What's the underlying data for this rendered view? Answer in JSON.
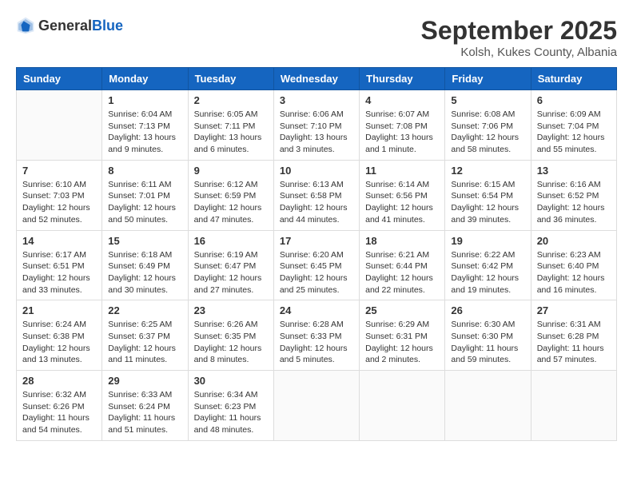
{
  "logo": {
    "general": "General",
    "blue": "Blue"
  },
  "header": {
    "month": "September 2025",
    "location": "Kolsh, Kukes County, Albania"
  },
  "weekdays": [
    "Sunday",
    "Monday",
    "Tuesday",
    "Wednesday",
    "Thursday",
    "Friday",
    "Saturday"
  ],
  "weeks": [
    [
      {
        "day": "",
        "info": ""
      },
      {
        "day": "1",
        "info": "Sunrise: 6:04 AM\nSunset: 7:13 PM\nDaylight: 13 hours\nand 9 minutes."
      },
      {
        "day": "2",
        "info": "Sunrise: 6:05 AM\nSunset: 7:11 PM\nDaylight: 13 hours\nand 6 minutes."
      },
      {
        "day": "3",
        "info": "Sunrise: 6:06 AM\nSunset: 7:10 PM\nDaylight: 13 hours\nand 3 minutes."
      },
      {
        "day": "4",
        "info": "Sunrise: 6:07 AM\nSunset: 7:08 PM\nDaylight: 13 hours\nand 1 minute."
      },
      {
        "day": "5",
        "info": "Sunrise: 6:08 AM\nSunset: 7:06 PM\nDaylight: 12 hours\nand 58 minutes."
      },
      {
        "day": "6",
        "info": "Sunrise: 6:09 AM\nSunset: 7:04 PM\nDaylight: 12 hours\nand 55 minutes."
      }
    ],
    [
      {
        "day": "7",
        "info": "Sunrise: 6:10 AM\nSunset: 7:03 PM\nDaylight: 12 hours\nand 52 minutes."
      },
      {
        "day": "8",
        "info": "Sunrise: 6:11 AM\nSunset: 7:01 PM\nDaylight: 12 hours\nand 50 minutes."
      },
      {
        "day": "9",
        "info": "Sunrise: 6:12 AM\nSunset: 6:59 PM\nDaylight: 12 hours\nand 47 minutes."
      },
      {
        "day": "10",
        "info": "Sunrise: 6:13 AM\nSunset: 6:58 PM\nDaylight: 12 hours\nand 44 minutes."
      },
      {
        "day": "11",
        "info": "Sunrise: 6:14 AM\nSunset: 6:56 PM\nDaylight: 12 hours\nand 41 minutes."
      },
      {
        "day": "12",
        "info": "Sunrise: 6:15 AM\nSunset: 6:54 PM\nDaylight: 12 hours\nand 39 minutes."
      },
      {
        "day": "13",
        "info": "Sunrise: 6:16 AM\nSunset: 6:52 PM\nDaylight: 12 hours\nand 36 minutes."
      }
    ],
    [
      {
        "day": "14",
        "info": "Sunrise: 6:17 AM\nSunset: 6:51 PM\nDaylight: 12 hours\nand 33 minutes."
      },
      {
        "day": "15",
        "info": "Sunrise: 6:18 AM\nSunset: 6:49 PM\nDaylight: 12 hours\nand 30 minutes."
      },
      {
        "day": "16",
        "info": "Sunrise: 6:19 AM\nSunset: 6:47 PM\nDaylight: 12 hours\nand 27 minutes."
      },
      {
        "day": "17",
        "info": "Sunrise: 6:20 AM\nSunset: 6:45 PM\nDaylight: 12 hours\nand 25 minutes."
      },
      {
        "day": "18",
        "info": "Sunrise: 6:21 AM\nSunset: 6:44 PM\nDaylight: 12 hours\nand 22 minutes."
      },
      {
        "day": "19",
        "info": "Sunrise: 6:22 AM\nSunset: 6:42 PM\nDaylight: 12 hours\nand 19 minutes."
      },
      {
        "day": "20",
        "info": "Sunrise: 6:23 AM\nSunset: 6:40 PM\nDaylight: 12 hours\nand 16 minutes."
      }
    ],
    [
      {
        "day": "21",
        "info": "Sunrise: 6:24 AM\nSunset: 6:38 PM\nDaylight: 12 hours\nand 13 minutes."
      },
      {
        "day": "22",
        "info": "Sunrise: 6:25 AM\nSunset: 6:37 PM\nDaylight: 12 hours\nand 11 minutes."
      },
      {
        "day": "23",
        "info": "Sunrise: 6:26 AM\nSunset: 6:35 PM\nDaylight: 12 hours\nand 8 minutes."
      },
      {
        "day": "24",
        "info": "Sunrise: 6:28 AM\nSunset: 6:33 PM\nDaylight: 12 hours\nand 5 minutes."
      },
      {
        "day": "25",
        "info": "Sunrise: 6:29 AM\nSunset: 6:31 PM\nDaylight: 12 hours\nand 2 minutes."
      },
      {
        "day": "26",
        "info": "Sunrise: 6:30 AM\nSunset: 6:30 PM\nDaylight: 11 hours\nand 59 minutes."
      },
      {
        "day": "27",
        "info": "Sunrise: 6:31 AM\nSunset: 6:28 PM\nDaylight: 11 hours\nand 57 minutes."
      }
    ],
    [
      {
        "day": "28",
        "info": "Sunrise: 6:32 AM\nSunset: 6:26 PM\nDaylight: 11 hours\nand 54 minutes."
      },
      {
        "day": "29",
        "info": "Sunrise: 6:33 AM\nSunset: 6:24 PM\nDaylight: 11 hours\nand 51 minutes."
      },
      {
        "day": "30",
        "info": "Sunrise: 6:34 AM\nSunset: 6:23 PM\nDaylight: 11 hours\nand 48 minutes."
      },
      {
        "day": "",
        "info": ""
      },
      {
        "day": "",
        "info": ""
      },
      {
        "day": "",
        "info": ""
      },
      {
        "day": "",
        "info": ""
      }
    ]
  ]
}
